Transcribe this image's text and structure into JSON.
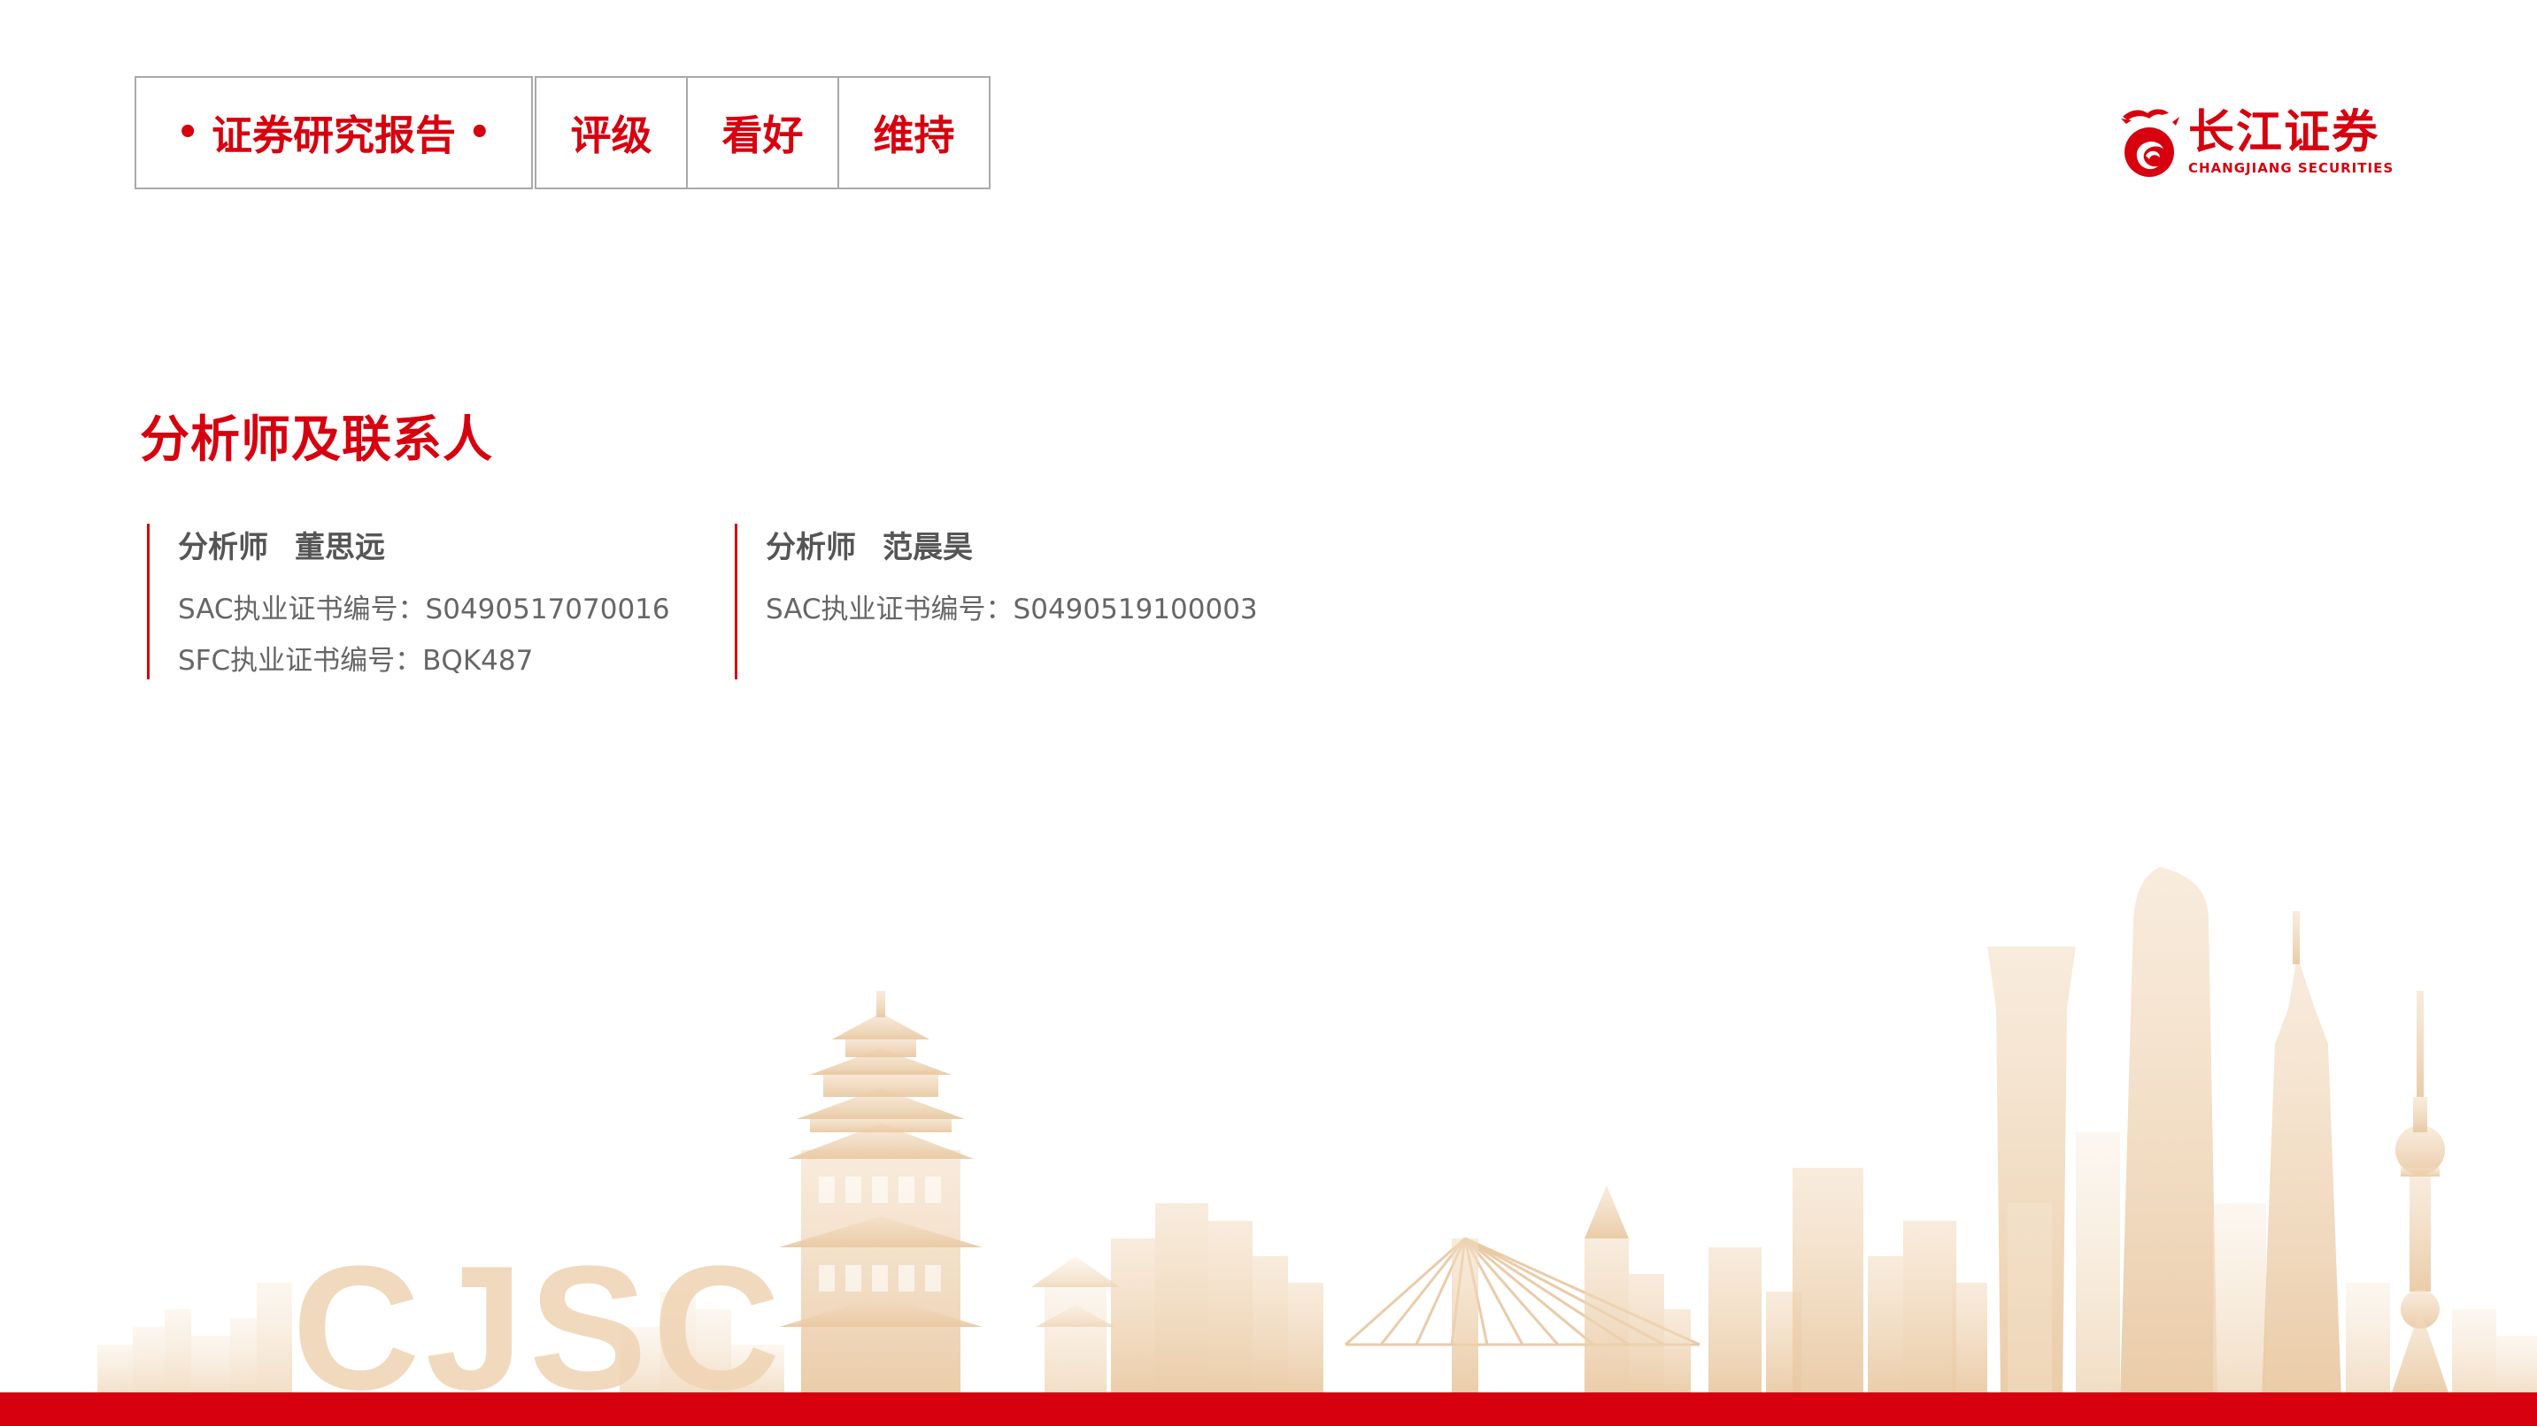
{
  "header": {
    "report_type": "证券研究报告",
    "report_bullet": "•",
    "rating_label": "评级",
    "rating_value": "看好",
    "rating_change": "维持"
  },
  "logo": {
    "name_cn": "长江证券",
    "name_en": "CHANGJIANG SECURITIES",
    "watermark": "CJSC"
  },
  "section": {
    "title": "分析师及联系人"
  },
  "analysts": [
    {
      "role": "分析师",
      "name": "董思远",
      "sac": "SAC执业证书编号：S0490517070016",
      "sfc": "SFC执业证书编号：BQK487"
    },
    {
      "role": "分析师",
      "name": "范晨昊",
      "sac": "SAC执业证书编号：S0490519100003"
    }
  ],
  "colors": {
    "brand_red": "#d7000f",
    "skyline_tan": "#f0d9bd",
    "box_border": "#a9a9a9",
    "text_grey": "#666666"
  }
}
